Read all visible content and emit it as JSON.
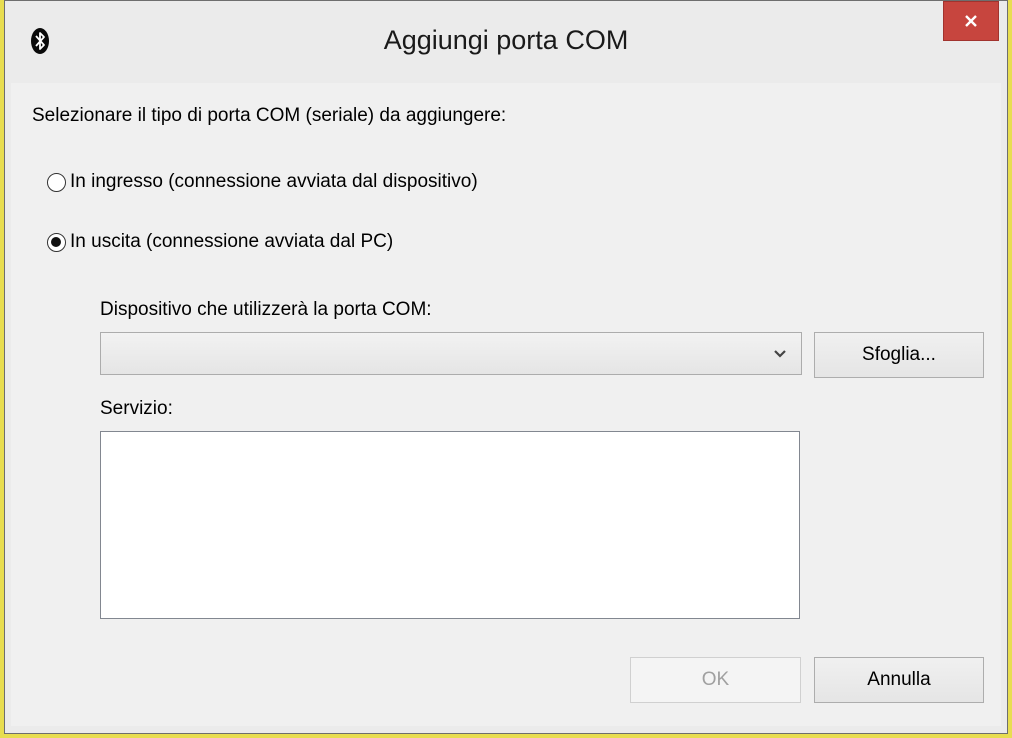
{
  "window": {
    "title": "Aggiungi porta COM"
  },
  "dialog": {
    "instruction": "Selezionare il tipo di porta COM (seriale) da aggiungere:",
    "radio_incoming": {
      "label": "In ingresso (connessione avviata dal dispositivo)",
      "checked": false
    },
    "radio_outgoing": {
      "label": "In uscita (connessione avviata dal PC)",
      "checked": true
    },
    "device_label": "Dispositivo che utilizzerà la porta COM:",
    "device_value": "",
    "browse_label": "Sfoglia...",
    "service_label": "Servizio:",
    "service_value": "",
    "ok_label": "OK",
    "ok_enabled": false,
    "cancel_label": "Annulla"
  },
  "icons": {
    "title": "bluetooth-icon",
    "close": "close-icon",
    "combo": "chevron-down-icon"
  },
  "colors": {
    "close_button": "#c7453e",
    "background": "#f0f0f0",
    "disabled_text": "#a0a0a0"
  }
}
